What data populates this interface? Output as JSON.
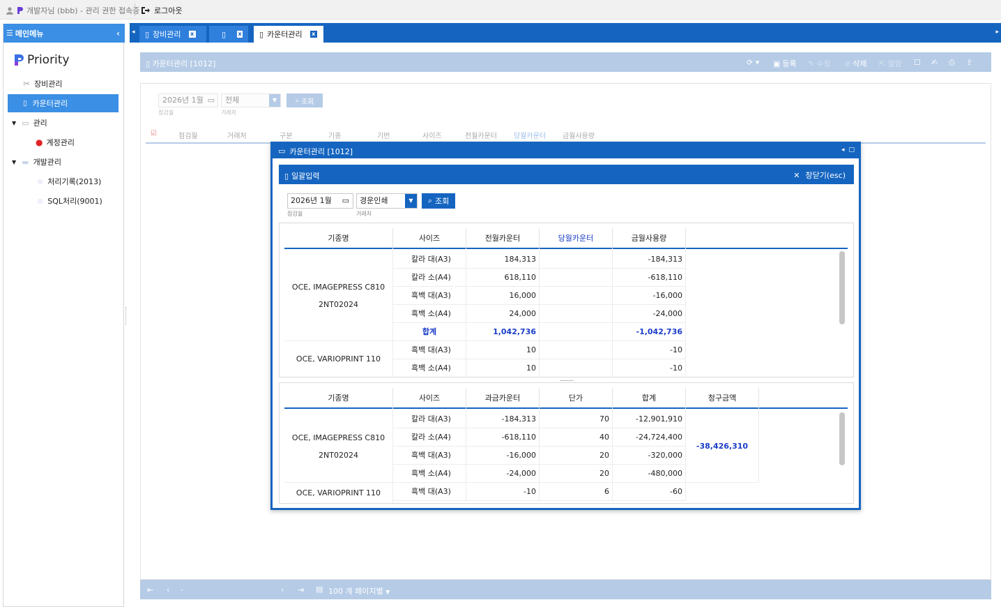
{
  "topbar": {
    "user_text": "개발자님 (bbb) - 관리 권한 접속중",
    "logout_label": "로그아웃"
  },
  "sidebar": {
    "header": "메인메뉴",
    "logo_text": "Priority",
    "items": [
      {
        "label": "장비관리",
        "icon": "wrench-icon"
      },
      {
        "label": "카운터관리",
        "icon": "document-icon"
      },
      {
        "label": "관리",
        "icon": "folder-open-icon"
      },
      {
        "label": "계정관리",
        "icon": "users-icon"
      },
      {
        "label": "개발관리",
        "icon": "folder-icon"
      },
      {
        "label": "처리기록(2013)",
        "icon": "layers-icon"
      },
      {
        "label": "SQL처리(9001)",
        "icon": "layers-icon"
      }
    ]
  },
  "tabs": [
    {
      "label": "장비관리"
    },
    {
      "label": ""
    },
    {
      "label": "카운터관리"
    }
  ],
  "page": {
    "title": "카운터관리 [1012]",
    "toolbar": {
      "register": "등록",
      "edit": "수정",
      "delete": "삭제",
      "open": "열람"
    },
    "filter": {
      "date": "2026년 1월",
      "date_label": "점검월",
      "vendor": "전체",
      "vendor_label": "거래처",
      "search": "조회"
    },
    "columns": [
      "점검월",
      "거래처",
      "구분",
      "기종",
      "기번",
      "사이즈",
      "전월카운터",
      "당월카운터",
      "금월사용량"
    ],
    "pager": {
      "page_size": "100 개 페이지별"
    }
  },
  "modal": {
    "title": "카운터관리 [1012]",
    "batch_label": "일괄입력",
    "close_label": "창닫기(esc)",
    "date": "2026년 1월",
    "date_label": "점검월",
    "vendor": "경운인쇄",
    "vendor_label": "거래처",
    "search": "조회",
    "grid1": {
      "headers": [
        "기종명",
        "사이즈",
        "전월카운터",
        "당월카운터",
        "금월사용량"
      ],
      "groups": [
        {
          "model": "OCE, IMAGEPRESS C810",
          "serial": "2NT02024"
        },
        {
          "model": "OCE, VARIOPRINT 110",
          "serial": ""
        }
      ],
      "rows": [
        {
          "size": "칼라 대(A3)",
          "prev": "184,313",
          "curr": "",
          "usage": "-184,313"
        },
        {
          "size": "칼라 소(A4)",
          "prev": "618,110",
          "curr": "",
          "usage": "-618,110"
        },
        {
          "size": "흑백 대(A3)",
          "prev": "16,000",
          "curr": "",
          "usage": "-16,000"
        },
        {
          "size": "흑백 소(A4)",
          "prev": "24,000",
          "curr": "",
          "usage": "-24,000"
        },
        {
          "size": "합계",
          "prev": "1,042,736",
          "curr": "",
          "usage": "-1,042,736"
        },
        {
          "size": "흑백 대(A3)",
          "prev": "10",
          "curr": "",
          "usage": "-10"
        },
        {
          "size": "흑백 소(A4)",
          "prev": "10",
          "curr": "",
          "usage": "-10"
        }
      ]
    },
    "grid2": {
      "headers": [
        "기종명",
        "사이즈",
        "과금카운터",
        "단가",
        "합계",
        "청구금액"
      ],
      "groups": [
        {
          "model": "OCE, IMAGEPRESS C810",
          "serial": "2NT02024"
        },
        {
          "model": "OCE, VARIOPRINT 110",
          "serial": ""
        }
      ],
      "bill_total": "-38,426,310",
      "rows": [
        {
          "size": "칼라 대(A3)",
          "count": "-184,313",
          "unit": "70",
          "sum": "-12,901,910"
        },
        {
          "size": "칼라 소(A4)",
          "count": "-618,110",
          "unit": "40",
          "sum": "-24,724,400"
        },
        {
          "size": "흑백 대(A3)",
          "count": "-16,000",
          "unit": "20",
          "sum": "-320,000"
        },
        {
          "size": "흑백 소(A4)",
          "count": "-24,000",
          "unit": "20",
          "sum": "-480,000"
        },
        {
          "size": "흑백 대(A3)",
          "count": "-10",
          "unit": "6",
          "sum": "-60"
        }
      ]
    }
  },
  "colors": {
    "primary": "#1565c0",
    "accent": "#3b8fe4",
    "muted_bar": "#b5cbe6",
    "total_text": "#1a3cc7"
  }
}
